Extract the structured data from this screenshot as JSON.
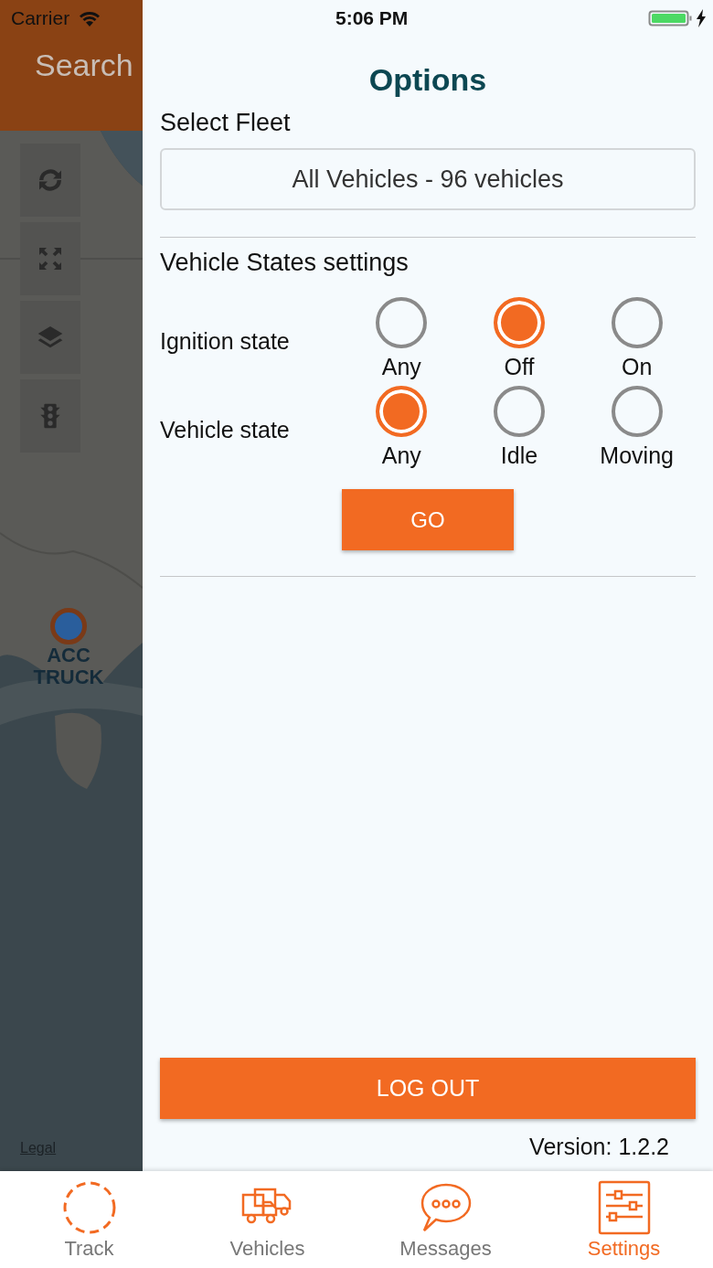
{
  "status_bar": {
    "carrier": "Carrier",
    "time": "5:06 PM"
  },
  "map": {
    "title": "Search",
    "marker_label": "ACC TRUCK",
    "legal": "Legal"
  },
  "options": {
    "title": "Options",
    "fleet_label": "Select Fleet",
    "fleet_value": "All Vehicles - 96 vehicles",
    "states_title": "Vehicle States settings",
    "groups": [
      {
        "label": "Ignition state",
        "choices": [
          {
            "label": "Any",
            "selected": false
          },
          {
            "label": "Off",
            "selected": true
          },
          {
            "label": "On",
            "selected": false
          }
        ]
      },
      {
        "label": "Vehicle state",
        "choices": [
          {
            "label": "Any",
            "selected": true
          },
          {
            "label": "Idle",
            "selected": false
          },
          {
            "label": "Moving",
            "selected": false
          }
        ]
      }
    ],
    "go": "GO"
  },
  "logout": "LOG OUT",
  "version": "Version: 1.2.2",
  "tabs": [
    {
      "label": "Track",
      "kind": "track",
      "selected": false
    },
    {
      "label": "Vehicles",
      "kind": "vehicles",
      "selected": false
    },
    {
      "label": "Messages",
      "kind": "messages",
      "selected": false
    },
    {
      "label": "Settings",
      "kind": "settings",
      "selected": true
    }
  ]
}
